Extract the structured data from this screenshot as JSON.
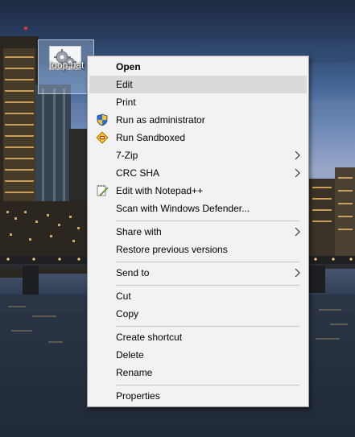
{
  "desktop": {
    "file": {
      "name": "loop.bat",
      "icon": "batch-file-gears-icon"
    }
  },
  "context_menu": {
    "items": [
      {
        "label": "Open",
        "bold": true
      },
      {
        "label": "Edit",
        "highlighted": true
      },
      {
        "label": "Print"
      },
      {
        "label": "Run as administrator",
        "icon": "uac-shield-icon"
      },
      {
        "label": "Run Sandboxed",
        "icon": "sandboxie-icon"
      },
      {
        "label": "7-Zip",
        "submenu": true
      },
      {
        "label": "CRC SHA",
        "submenu": true
      },
      {
        "label": "Edit with Notepad++",
        "icon": "notepad-plus-plus-icon"
      },
      {
        "label": "Scan with Windows Defender..."
      },
      {
        "label": "Share with",
        "submenu": true
      },
      {
        "label": "Restore previous versions"
      },
      {
        "label": "Send to",
        "submenu": true
      },
      {
        "label": "Cut"
      },
      {
        "label": "Copy"
      },
      {
        "label": "Create shortcut"
      },
      {
        "label": "Delete"
      },
      {
        "label": "Rename"
      },
      {
        "label": "Properties"
      }
    ],
    "colors": {
      "background": "#f2f2f2",
      "highlight": "#dadada",
      "border": "#a0a0a0"
    }
  }
}
